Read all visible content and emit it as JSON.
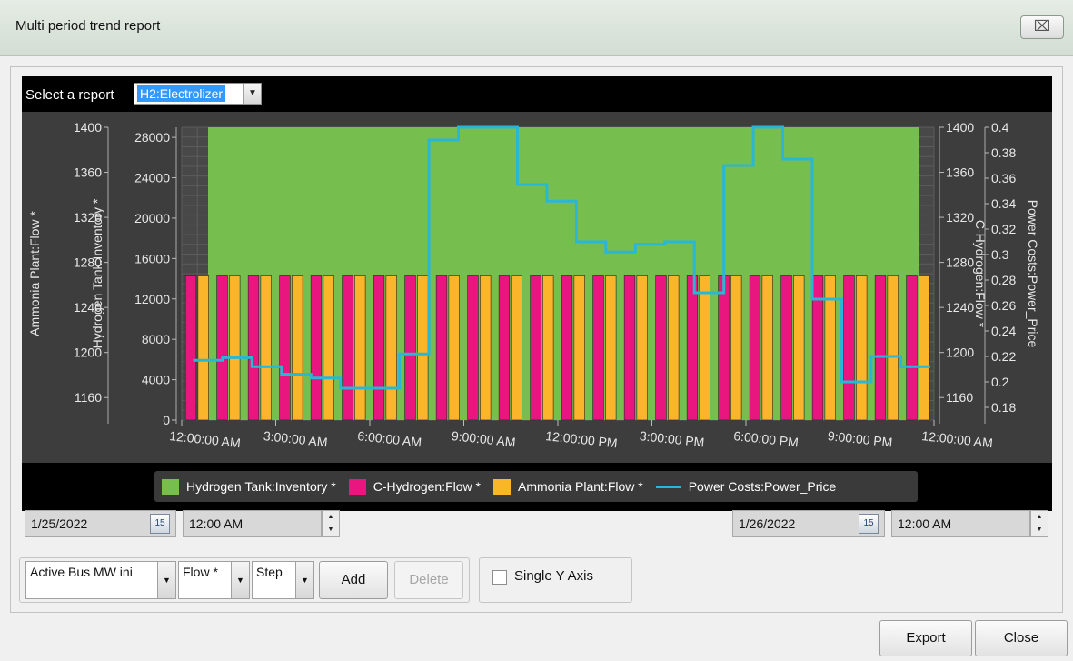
{
  "window": {
    "title": "Multi period trend report",
    "close_glyph": "⌧"
  },
  "report_selector": {
    "label": "Select a report",
    "value": "H2:Electrolizer"
  },
  "chart_data": {
    "type": "bar",
    "x_tick_labels": [
      "12:00:00 AM",
      "3:00:00 AM",
      "6:00:00 AM",
      "9:00:00 AM",
      "12:00:00 PM",
      "3:00:00 PM",
      "6:00:00 PM",
      "9:00:00 PM",
      "12:00:00 AM"
    ],
    "axes": {
      "left_outer": {
        "label": "Ammonia Plant:Flow *",
        "ticks": [
          "1400",
          "1360",
          "1320",
          "1280",
          "1240",
          "1200",
          "1160"
        ],
        "ylim": [
          1140,
          1400
        ]
      },
      "left_inner": {
        "label": "Hydrogen Tank:Inventory *",
        "ticks": [
          "28000",
          "24000",
          "20000",
          "16000",
          "12000",
          "8000",
          "4000",
          "0"
        ],
        "ylim": [
          0,
          29000
        ]
      },
      "right_inner": {
        "label": "C-Hydrogen:Flow *",
        "ticks": [
          "1400",
          "1360",
          "1320",
          "1280",
          "1240",
          "1200",
          "1160"
        ],
        "ylim": [
          1140,
          1400
        ]
      },
      "right_outer": {
        "label": "Power Costs:Power_Price",
        "ticks": [
          "0.4",
          "0.38",
          "0.36",
          "0.34",
          "0.32",
          "0.3",
          "0.28",
          "0.26",
          "0.24",
          "0.22",
          "0.2",
          "0.18"
        ],
        "ylim": [
          0.17,
          0.4
        ]
      }
    },
    "series": [
      {
        "name": "Hydrogen Tank:Inventory *",
        "kind": "area",
        "color": "#76bf4e",
        "value": 29000
      },
      {
        "name": "C-Hydrogen:Flow *",
        "kind": "bar",
        "color": "#e8167e",
        "value_count": 24,
        "value": 1268
      },
      {
        "name": "Ammonia Plant:Flow *",
        "kind": "bar",
        "color": "#fbb52a",
        "value_count": 24,
        "value": 1268
      },
      {
        "name": "Power Costs:Power_Price",
        "kind": "step",
        "color": "#29b7d6",
        "values": [
          0.217,
          0.219,
          0.212,
          0.206,
          0.203,
          0.195,
          0.195,
          0.222,
          0.39,
          0.4,
          0.4,
          0.355,
          0.342,
          0.31,
          0.302,
          0.308,
          0.31,
          0.27,
          0.37,
          0.4,
          0.375,
          0.265,
          0.2,
          0.22,
          0.212
        ]
      }
    ],
    "grid": true,
    "legend_position": "bottom"
  },
  "legend": [
    {
      "label": "Hydrogen Tank:Inventory *",
      "color": "#76bf4e",
      "kind": "box"
    },
    {
      "label": "C-Hydrogen:Flow *",
      "color": "#e8167e",
      "kind": "box"
    },
    {
      "label": "Ammonia Plant:Flow *",
      "color": "#fbb52a",
      "kind": "box"
    },
    {
      "label": "Power Costs:Power_Price",
      "color": "#29b7d6",
      "kind": "line"
    }
  ],
  "date_range": {
    "start_date": "1/25/2022",
    "start_time": "12:00 AM",
    "end_date": "1/26/2022",
    "end_time": "12:00 AM",
    "calendar_glyph": "15"
  },
  "controls": {
    "signal_combo": "Active Bus MW ini",
    "measure_combo": "Flow *",
    "interp_combo": "Step",
    "add_label": "Add",
    "delete_label": "Delete",
    "single_axis_label": "Single Y Axis"
  },
  "footer": {
    "export_label": "Export",
    "close_label": "Close"
  }
}
